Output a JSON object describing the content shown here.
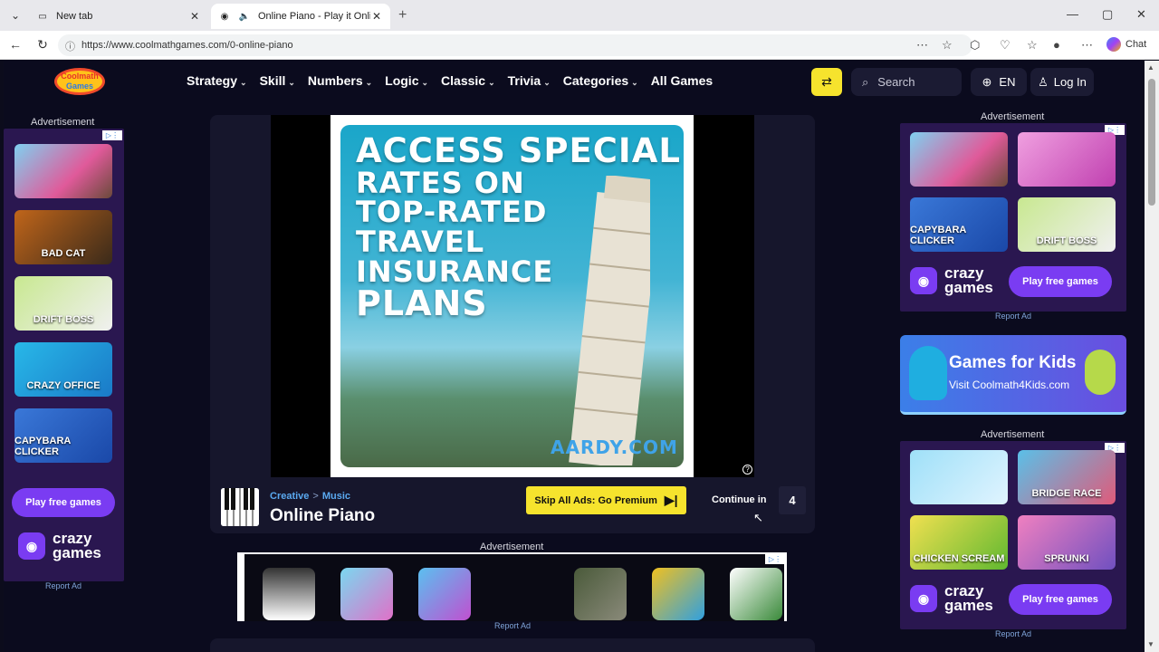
{
  "browser": {
    "tabs": [
      {
        "title": "New tab"
      },
      {
        "title": "Online Piano - Play it Online a"
      }
    ],
    "url": "https://www.coolmathgames.com/0-online-piano",
    "chat_label": "Chat"
  },
  "site": {
    "logo_text": "Coolmath Games",
    "nav": [
      "Strategy",
      "Skill",
      "Numbers",
      "Logic",
      "Classic",
      "Trivia",
      "Categories",
      "All Games"
    ],
    "search_placeholder": "Search",
    "lang": "EN",
    "login": "Log In"
  },
  "left_ad": {
    "label": "Advertisement",
    "games": [
      "BAD CAT",
      "DRIFT BOSS",
      "CRAZY OFFICE",
      "CAPYBARA CLICKER"
    ],
    "play_label": "Play free games",
    "brand": [
      "crazy",
      "games"
    ],
    "report": "Report Ad"
  },
  "right_ad_top": {
    "label": "Advertisement",
    "games": [
      "CAPYBARA CLICKER",
      "DRIFT BOSS"
    ],
    "play_label": "Play free games",
    "brand": [
      "crazy",
      "games"
    ],
    "report": "Report Ad"
  },
  "kids_banner": {
    "title": "Games for Kids",
    "subtitle": "Visit Coolmath4Kids.com"
  },
  "right_ad_bottom": {
    "label": "Advertisement",
    "games": [
      "BRIDGE RACE",
      "CHICKEN SCREAM",
      "SPRUNKI"
    ],
    "play_label": "Play free games",
    "brand": [
      "crazy",
      "games"
    ],
    "report": "Report Ad"
  },
  "travel_ad": {
    "lines": [
      "ACCESS SPECIAL",
      "RATES ON",
      "TOP-RATED",
      "TRAVEL",
      "INSURANCE",
      "PLANS"
    ],
    "brand": "AARDY.COM"
  },
  "game": {
    "crumb_category": "Creative",
    "crumb_sep": ">",
    "crumb_sub": "Music",
    "title": "Online Piano",
    "skip_label": "Skip All Ads: Go Premium",
    "continue_label": "Continue in",
    "countdown": "4"
  },
  "bottom_ad": {
    "label": "Advertisement",
    "report": "Report Ad"
  }
}
